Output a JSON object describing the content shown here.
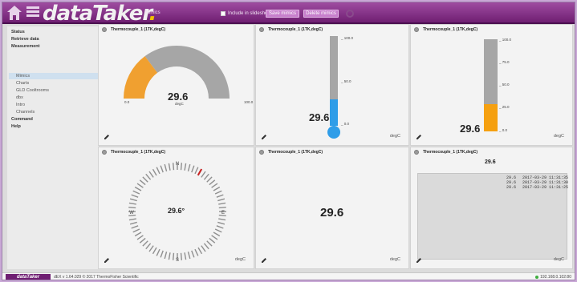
{
  "header": {
    "brand": "dataTaker",
    "current_page": "Mimics",
    "include_slideshow_label": "Include in slideshow",
    "save_button": "Save mimics",
    "delete_button": "Delete mimics"
  },
  "sidebar": {
    "items": [
      {
        "label": "Status",
        "level": 0
      },
      {
        "label": "Retrieve data",
        "level": 0
      },
      {
        "label": "Measurement",
        "level": 0
      },
      {
        "label": "Mimics",
        "level": 1,
        "selected": true
      },
      {
        "label": "Charts",
        "level": 1
      },
      {
        "label": "GLD Cooltrooms",
        "level": 1
      },
      {
        "label": "dbx",
        "level": 1
      },
      {
        "label": "Intro",
        "level": 1
      },
      {
        "label": "Channels",
        "level": 1
      },
      {
        "label": "Command",
        "level": 0
      },
      {
        "label": "Help",
        "level": 0
      }
    ]
  },
  "panels": {
    "gauge": {
      "title": "Thermocouple_1 (1TK,degC)",
      "value": "29.6",
      "unit": "degC",
      "min_label": "0.0",
      "max_label": "100.0",
      "value_fraction": 0.296,
      "fill_color": "#f0a030",
      "track_color": "#a6a6a6"
    },
    "thermometer": {
      "title": "Thermocouple_1 (1TK,degC)",
      "value": "29.6",
      "unit": "degC",
      "ticks": [
        "100.0",
        "50.0",
        "0.0"
      ],
      "value_fraction": 0.296,
      "fill_color": "#2f9de8"
    },
    "bar": {
      "title": "Thermocouple_1 (1TK,degC)",
      "value": "29.6",
      "unit": "degC",
      "ticks": [
        "100.0",
        "75.0",
        "50.0",
        "25.0",
        "0.0"
      ],
      "value_fraction": 0.296,
      "fill_color": "#f5a010"
    },
    "compass": {
      "title": "Thermocouple_1 (1TK,degC)",
      "value": "29.6°",
      "unit": "degC",
      "directions": {
        "n": "N",
        "e": "E",
        "s": "S",
        "w": "W"
      },
      "needle_color": "#cc2222"
    },
    "numeric": {
      "title": "Thermocouple_1 (1TK,degC)",
      "value": "29.6",
      "unit": "degC"
    },
    "history": {
      "title": "Thermocouple_1 (1TK,degC)",
      "value": "29.6",
      "unit": "degC",
      "rows": [
        {
          "value": "29.6",
          "time": "2017-03-29 11:31:35"
        },
        {
          "value": "29.6",
          "time": "2017-03-29 11:31:30"
        },
        {
          "value": "29.6",
          "time": "2017-03-29 11:31:25"
        }
      ]
    }
  },
  "statusbar": {
    "logo": "dataTaker",
    "version": "dEX v 1.64.029 © 2017 ThermoFisher Scientific",
    "ip": "192.168.0.102:80"
  }
}
